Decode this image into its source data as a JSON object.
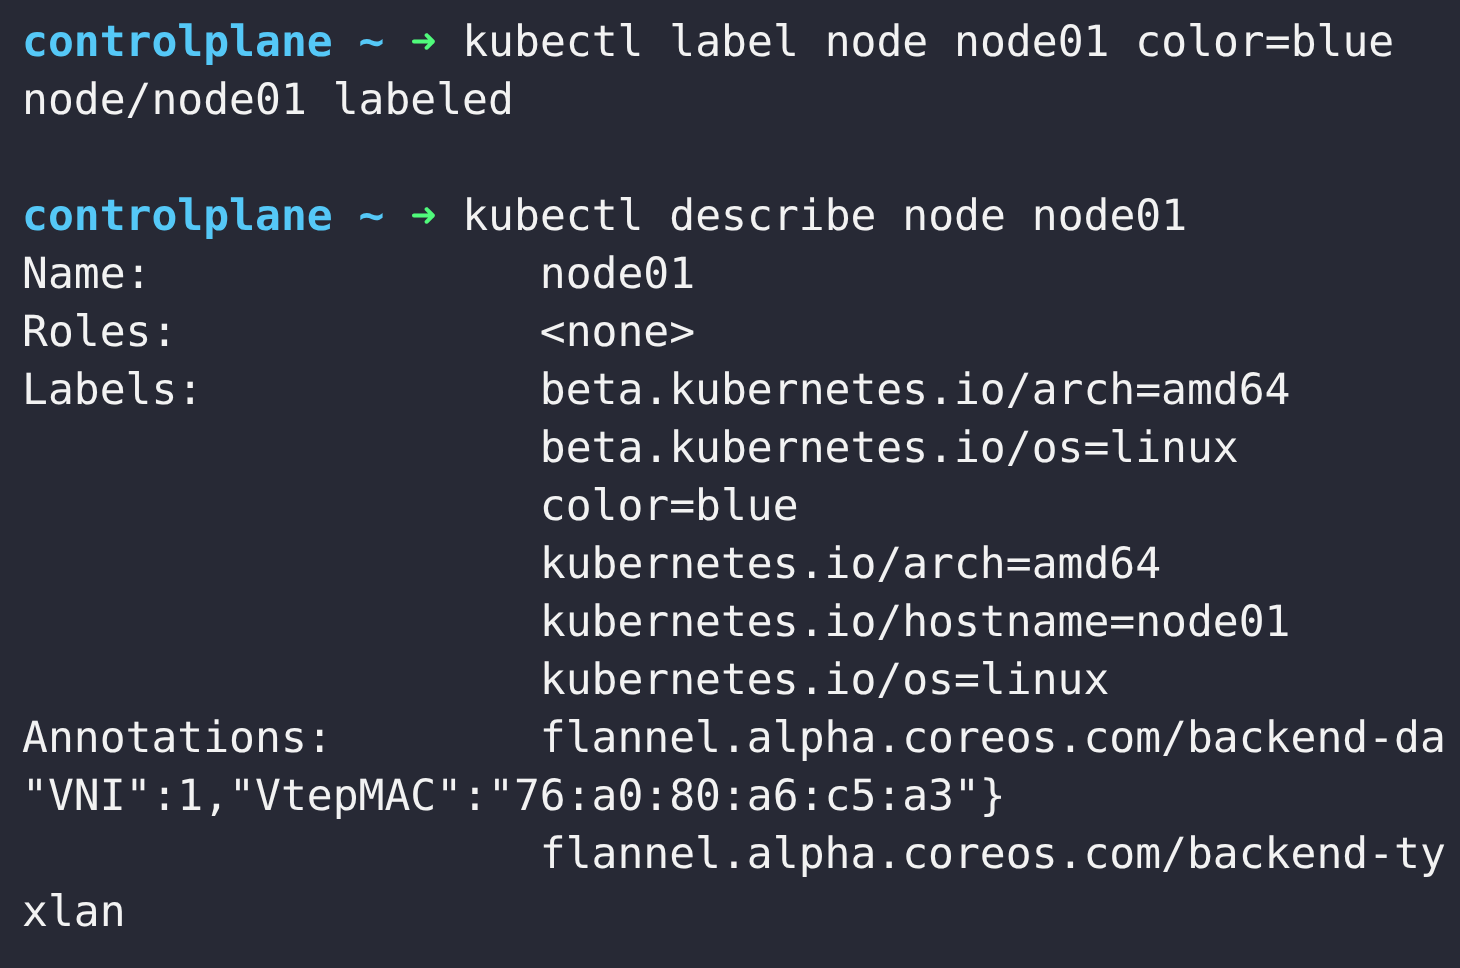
{
  "terminal": {
    "lines": [
      {
        "kind": "prompt",
        "host": "controlplane",
        "path": "~",
        "arrow": "➜",
        "command": "kubectl label node node01 color=blue"
      },
      {
        "kind": "output",
        "text": "node/node01 labeled"
      },
      {
        "kind": "blank"
      },
      {
        "kind": "prompt",
        "host": "controlplane",
        "path": "~",
        "arrow": "➜",
        "command": "kubectl describe node node01"
      },
      {
        "kind": "field",
        "key": "Name:",
        "value": "node01"
      },
      {
        "kind": "field",
        "key": "Roles:",
        "value": "<none>"
      },
      {
        "kind": "field",
        "key": "Labels:",
        "value": "beta.kubernetes.io/arch=amd64"
      },
      {
        "kind": "indent",
        "value": "beta.kubernetes.io/os=linux"
      },
      {
        "kind": "indent",
        "value": "color=blue"
      },
      {
        "kind": "indent",
        "value": "kubernetes.io/arch=amd64"
      },
      {
        "kind": "indent",
        "value": "kubernetes.io/hostname=node01"
      },
      {
        "kind": "indent",
        "value": "kubernetes.io/os=linux"
      },
      {
        "kind": "field",
        "key": "Annotations:",
        "value": "flannel.alpha.coreos.com/backend-da"
      },
      {
        "kind": "output",
        "text": "\"VNI\":1,\"VtepMAC\":\"76:a0:80:a6:c5:a3\"}"
      },
      {
        "kind": "indent",
        "value": "flannel.alpha.coreos.com/backend-ty"
      },
      {
        "kind": "output",
        "text": "xlan"
      }
    ]
  }
}
